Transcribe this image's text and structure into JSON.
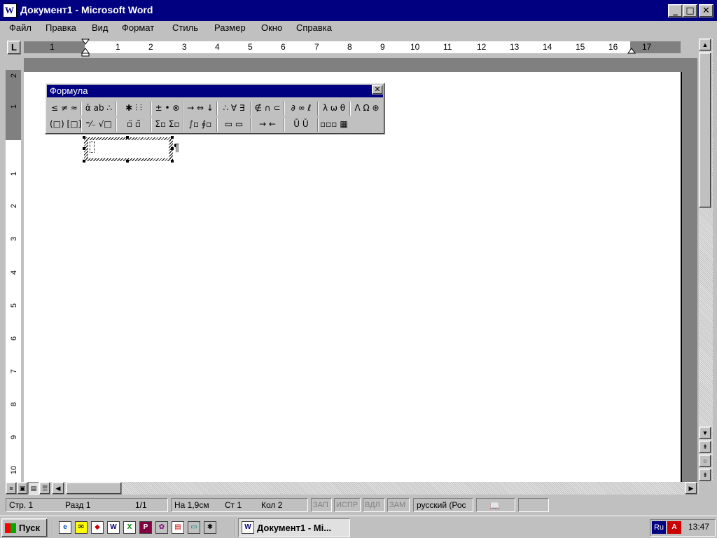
{
  "window": {
    "title": "Документ1 - Microsoft Word",
    "app_icon_letter": "W",
    "min_glyph": "_",
    "max_glyph": "□",
    "close_glyph": "✕"
  },
  "menu": [
    "Файл",
    "Правка",
    "Вид",
    "Формат",
    "Стиль",
    "Размер",
    "Окно",
    "Справка"
  ],
  "ruler": {
    "tab_selector": "L",
    "h_ticks": [
      "1",
      "1",
      "2",
      "3",
      "4",
      "5",
      "6",
      "7",
      "8",
      "9",
      "10",
      "11",
      "12",
      "13",
      "14",
      "15",
      "16",
      "17"
    ],
    "v_ticks": [
      "2",
      "1",
      "1",
      "2",
      "3",
      "4",
      "5",
      "6",
      "7",
      "8",
      "9",
      "10"
    ]
  },
  "formula_toolbar": {
    "title": "Формула",
    "close_glyph": "✕",
    "row1": [
      "≤ ≠ ≈",
      "ἀ ab ∴",
      "✱ ⫶ ⫶",
      "± • ⊗",
      "→ ⇔ ↓",
      "∴ ∀ ∃",
      "∉ ∩ ⊂",
      "∂ ∞ ℓ",
      "λ ω θ",
      "Λ Ω ⊛"
    ],
    "row2": [
      "(□) [□]",
      "⁼⁄₋ √□",
      "▫̈ ▫̃",
      "Σ▫ Σ▫",
      "∫▫ ∮▫",
      "▭ ▭",
      "→ ←",
      "Ū Ǔ",
      "▫▫▫",
      "▦"
    ]
  },
  "equation": {
    "paragraph_mark": "¶"
  },
  "scrollbar": {
    "up": "▲",
    "down": "▼",
    "prev_page": "⇞",
    "select_browse": "○",
    "next_page": "⇟",
    "left": "◀",
    "right": "▶"
  },
  "statusbar": {
    "page": "Стр.  1",
    "section": "Разд  1",
    "pages": "1/1",
    "at": "На 1,9см",
    "line": "Ст 1",
    "col": "Кол 2",
    "rec": "ЗАП",
    "trk": "ИСПР",
    "ext": "ВДЛ",
    "ovr": "ЗАМ",
    "language": "русский (Рос"
  },
  "taskbar": {
    "start_label": "Пуск",
    "task_label": "Документ1 - Mi...",
    "lang": "Ru",
    "time": "13:47"
  }
}
